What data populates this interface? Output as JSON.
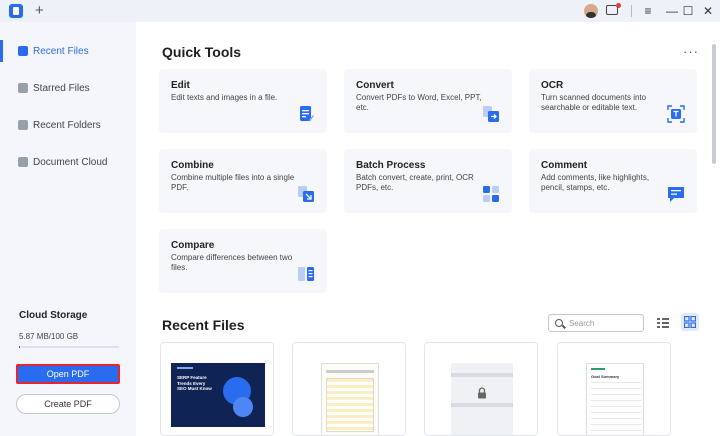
{
  "titlebar": {
    "new_tab": "+",
    "controls": {
      "menu": "≡",
      "minimize": "—",
      "maximize": "☐",
      "close": "✕"
    }
  },
  "sidebar": {
    "items": [
      {
        "label": "Recent Files",
        "icon": "clock-icon",
        "active": true
      },
      {
        "label": "Starred Files",
        "icon": "star-icon",
        "active": false
      },
      {
        "label": "Recent Folders",
        "icon": "folder-icon",
        "active": false
      },
      {
        "label": "Document Cloud",
        "icon": "cloud-icon",
        "active": false
      }
    ],
    "cloud_storage": {
      "title": "Cloud Storage",
      "usage": "5.87 MB/100 GB",
      "used_fraction": 0.0001
    },
    "open_pdf": "Open PDF",
    "create_pdf": "Create PDF"
  },
  "main": {
    "quick_tools_title": "Quick Tools",
    "more": "···",
    "tools": [
      {
        "title": "Edit",
        "desc": "Edit texts and images in a file.",
        "icon": "edit-icon"
      },
      {
        "title": "Convert",
        "desc": "Convert PDFs to Word, Excel, PPT, etc.",
        "icon": "convert-icon"
      },
      {
        "title": "OCR",
        "desc": "Turn scanned documents into searchable or editable text.",
        "icon": "ocr-icon"
      },
      {
        "title": "Combine",
        "desc": "Combine multiple files into a single PDF.",
        "icon": "combine-icon"
      },
      {
        "title": "Batch Process",
        "desc": "Batch convert, create, print, OCR PDFs, etc.",
        "icon": "batch-icon"
      },
      {
        "title": "Comment",
        "desc": "Add comments, like highlights, pencil, stamps, etc.",
        "icon": "comment-icon"
      },
      {
        "title": "Compare",
        "desc": "Compare differences between two files.",
        "icon": "compare-icon"
      }
    ],
    "recent_files_title": "Recent Files",
    "search": {
      "placeholder": "Search"
    },
    "thumbnails": [
      {
        "kind": "dark-infographic",
        "heading": "SERP Feature Trends Every SEO Must Know"
      },
      {
        "kind": "spreadsheet-document"
      },
      {
        "kind": "locked-document"
      },
      {
        "kind": "report-document",
        "heading": "Goal Summary"
      }
    ]
  }
}
